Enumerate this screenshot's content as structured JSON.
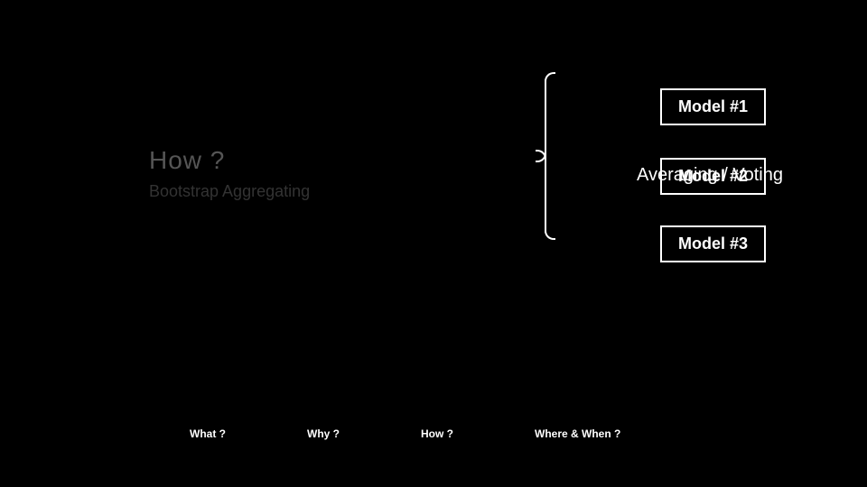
{
  "title": {
    "main": "How ?",
    "sub": "Bootstrap Aggregating"
  },
  "boxes": {
    "model1": "Model #1",
    "model2": "Model #2",
    "model3": "Model #3"
  },
  "overlay": {
    "avg_voting": "Averaging / Voting"
  },
  "nav": {
    "what": "What ?",
    "why": "Why ?",
    "how": "How ?",
    "where_when": "Where & When ?"
  }
}
